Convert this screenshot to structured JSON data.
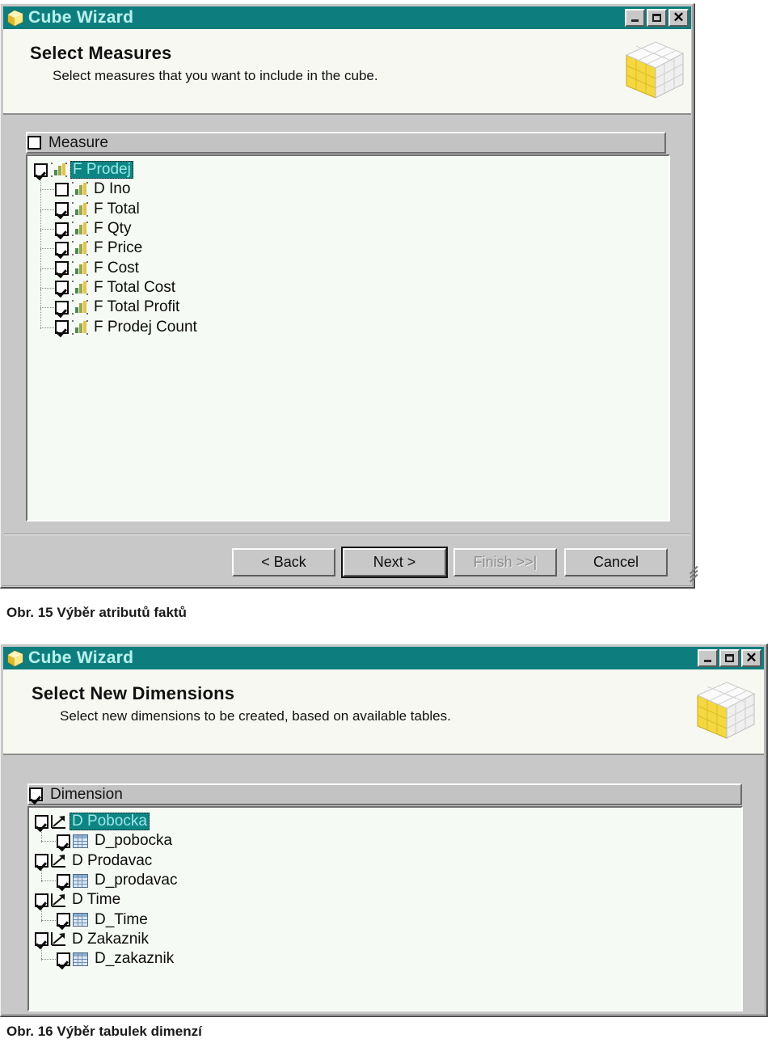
{
  "figure1": {
    "window": {
      "title": "Cube Wizard",
      "icon": "cube-icon",
      "buttons": {
        "minimize": "minimize-icon",
        "maximize": "maximize-icon",
        "close": "close-icon"
      }
    },
    "banner": {
      "title": "Select Measures",
      "subtitle": "Select measures that you want to include in the cube.",
      "graphic": "cube-graphic"
    },
    "list_header": {
      "label": "Measure",
      "checked": false
    },
    "tree": [
      {
        "label": "F Prodej",
        "checked": true,
        "level": 0,
        "icon": "measure-bars-icon",
        "selected": true
      },
      {
        "label": "D Ino",
        "checked": false,
        "level": 1,
        "icon": "measure-bars-icon",
        "selected": false
      },
      {
        "label": "F Total",
        "checked": true,
        "level": 1,
        "icon": "measure-bars-icon",
        "selected": false
      },
      {
        "label": "F Qty",
        "checked": true,
        "level": 1,
        "icon": "measure-bars-icon",
        "selected": false
      },
      {
        "label": "F Price",
        "checked": true,
        "level": 1,
        "icon": "measure-bars-icon",
        "selected": false
      },
      {
        "label": "F Cost",
        "checked": true,
        "level": 1,
        "icon": "measure-bars-icon",
        "selected": false
      },
      {
        "label": "F Total Cost",
        "checked": true,
        "level": 1,
        "icon": "measure-bars-icon",
        "selected": false
      },
      {
        "label": "F Total Profit",
        "checked": true,
        "level": 1,
        "icon": "measure-bars-icon",
        "selected": false
      },
      {
        "label": "F Prodej Count",
        "checked": true,
        "level": 1,
        "icon": "measure-bars-icon",
        "selected": false
      }
    ],
    "buttons": [
      {
        "label": "< Back",
        "state": "normal",
        "name": "back-button"
      },
      {
        "label": "Next >",
        "state": "default",
        "name": "next-button"
      },
      {
        "label": "Finish >>|",
        "state": "disabled",
        "name": "finish-button"
      },
      {
        "label": "Cancel",
        "state": "normal",
        "name": "cancel-button"
      }
    ],
    "caption": "Obr. 15 Výběr atributů faktů"
  },
  "figure2": {
    "window": {
      "title": "Cube Wizard",
      "icon": "cube-icon",
      "buttons": {
        "minimize": "minimize-icon",
        "maximize": "maximize-icon",
        "close": "close-icon"
      }
    },
    "banner": {
      "title": "Select New Dimensions",
      "subtitle": "Select new dimensions to be created, based on available tables.",
      "graphic": "cube-graphic"
    },
    "list_header": {
      "label": "Dimension",
      "checked": true
    },
    "tree": [
      {
        "label": "D Pobocka",
        "checked": true,
        "level": 0,
        "icon": "dimension-axis-icon",
        "selected": true
      },
      {
        "label": "D_pobocka",
        "checked": true,
        "level": 1,
        "icon": "table-icon",
        "selected": false
      },
      {
        "label": "D Prodavac",
        "checked": true,
        "level": 0,
        "icon": "dimension-axis-icon",
        "selected": false
      },
      {
        "label": "D_prodavac",
        "checked": true,
        "level": 1,
        "icon": "table-icon",
        "selected": false
      },
      {
        "label": "D Time",
        "checked": true,
        "level": 0,
        "icon": "dimension-axis-icon",
        "selected": false
      },
      {
        "label": "D_Time",
        "checked": true,
        "level": 1,
        "icon": "table-icon",
        "selected": false
      },
      {
        "label": "D Zakaznik",
        "checked": true,
        "level": 0,
        "icon": "dimension-axis-icon",
        "selected": false
      },
      {
        "label": "D_zakaznik",
        "checked": true,
        "level": 1,
        "icon": "table-icon",
        "selected": false
      }
    ],
    "caption": "Obr. 16 Výběr tabulek dimenzí"
  },
  "colors": {
    "titlebar": "#0d7d7d",
    "titlebar_text": "#b7f0ec",
    "selection": "#0e8585",
    "selection_text": "#9ce8e6",
    "window_face": "#c8c8c8",
    "banner_face": "#f7f8f2",
    "list_face": "#f6faf4"
  }
}
